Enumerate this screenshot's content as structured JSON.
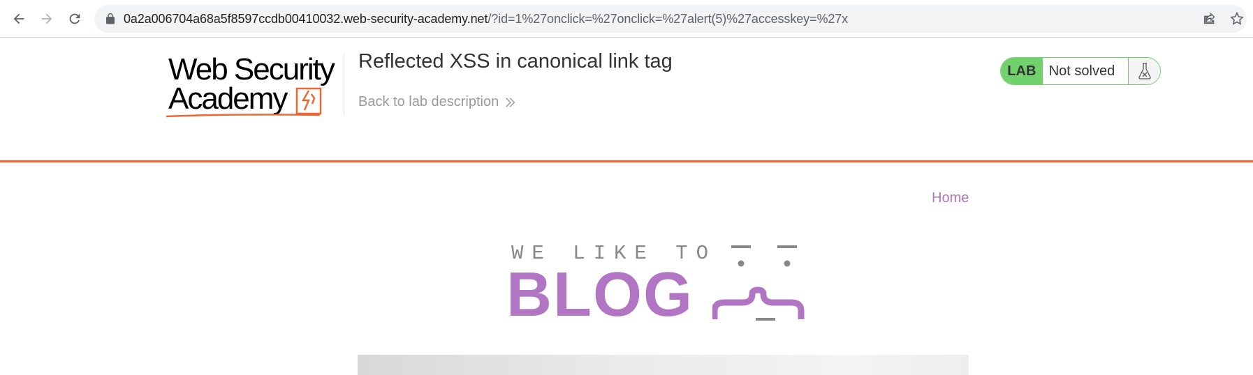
{
  "browser": {
    "url_domain": "0a2a006704a68a5f8597ccdb00410032.web-security-academy.net",
    "url_path": "/?id=1%27onclick=%27onclick=%27alert(5)%27accesskey=%27x"
  },
  "lab": {
    "logo_alt": "Web Security Academy",
    "title": "Reflected XSS in canonical link tag",
    "back_link": "Back to lab description",
    "status_badge": "LAB",
    "status_text": "Not solved"
  },
  "blog": {
    "nav_home": "Home",
    "logo_tagline": "WE LIKE TO",
    "logo_word": "BLOG"
  },
  "colors": {
    "accent_orange": "#ec6733",
    "blog_purple": "#b175c4",
    "lab_green": "#70d16d"
  }
}
